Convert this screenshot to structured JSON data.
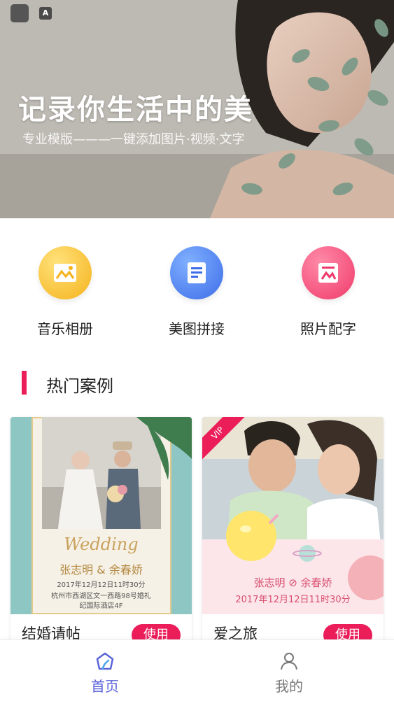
{
  "banner": {
    "title": "记录你生活中的美",
    "subtitle": "专业模版———一键添加图片·视频·文字"
  },
  "features": [
    {
      "label": "音乐相册",
      "icon": "photo-album-icon",
      "color": "#f5b21d"
    },
    {
      "label": "美图拼接",
      "icon": "document-icon",
      "color": "#3e6de8"
    },
    {
      "label": "照片配字",
      "icon": "photo-text-icon",
      "color": "#ef3a6b"
    }
  ],
  "section": {
    "title": "热门案例",
    "accent": "#ec1e5a"
  },
  "cards": [
    {
      "name": "结婚请帖",
      "use_label": "使用",
      "invite": {
        "script": "Wedding",
        "names": "张志明 & 余春娇",
        "date": "2017年12月12日11时30分",
        "address_1": "杭州市西湖区文一西路98号婚礼",
        "address_2": "纪国际酒店4F"
      }
    },
    {
      "name": "爱之旅",
      "use_label": "使用",
      "badge": "VIP",
      "invite": {
        "names": "张志明 ⊘ 余春娇",
        "date": "2017年12月12日11时30分"
      }
    }
  ],
  "bottom_nav": [
    {
      "label": "首页",
      "icon": "home-icon",
      "active": true,
      "color": "#5a63d8"
    },
    {
      "label": "我的",
      "icon": "user-icon",
      "active": false,
      "color": "#777777"
    }
  ]
}
